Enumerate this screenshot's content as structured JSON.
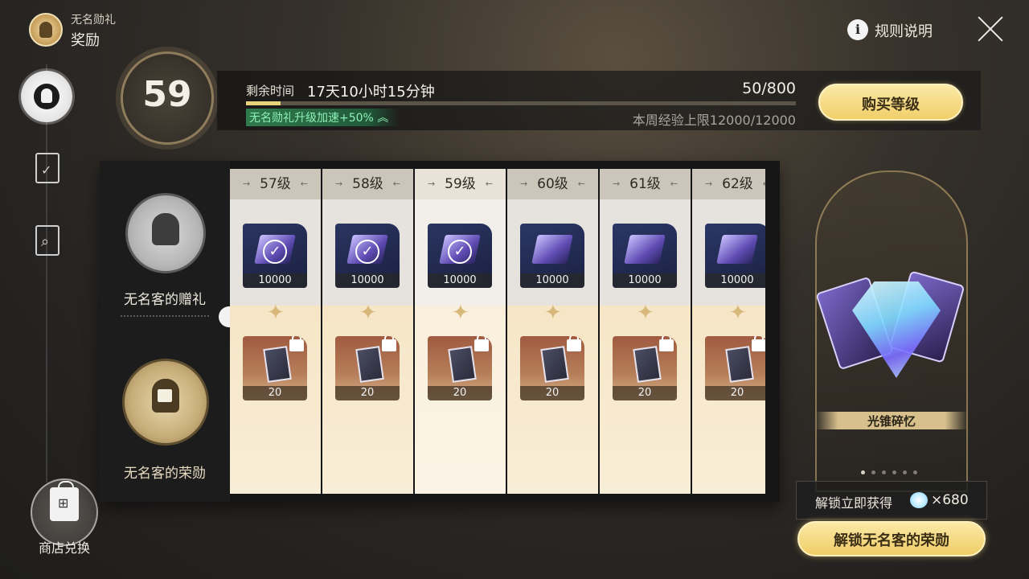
{
  "header": {
    "subtitle": "无名勋礼",
    "title": "奖励",
    "rules_label": "规则说明",
    "rules_icon": "info-icon",
    "close_icon": "close-icon"
  },
  "nav": {
    "items": [
      "reward-icon",
      "task-clipboard-icon",
      "search-document-icon"
    ],
    "shop_label": "商店兑换"
  },
  "level": {
    "current": "59",
    "time_label": "剩余时间",
    "time_value": "17天10小时15分钟",
    "exp_text": "50/800",
    "exp_fraction": 0.0625,
    "boost_text": "无名勋礼升级加速+50%",
    "weekly_cap": "本周经验上限12000/12000",
    "buy_label": "购买等级"
  },
  "tracks": {
    "free_label": "无名客的赠礼",
    "premium_label": "无名客的荣勋"
  },
  "levels": [
    {
      "label": "57级",
      "free_qty": "10000",
      "free_claimed": true,
      "premium_qty": "20",
      "premium_locked": true
    },
    {
      "label": "58级",
      "free_qty": "10000",
      "free_claimed": true,
      "premium_qty": "20",
      "premium_locked": true
    },
    {
      "label": "59级",
      "free_qty": "10000",
      "free_claimed": true,
      "premium_qty": "20",
      "premium_locked": true,
      "current": true
    },
    {
      "label": "60级",
      "free_qty": "10000",
      "free_claimed": false,
      "premium_qty": "20",
      "premium_locked": true
    },
    {
      "label": "61级",
      "free_qty": "10000",
      "free_claimed": false,
      "premium_qty": "20",
      "premium_locked": true
    },
    {
      "label": "62级",
      "free_qty": "10000",
      "free_claimed": false,
      "premium_qty": "20",
      "premium_locked": true
    }
  ],
  "feature": {
    "label": "光锥碎忆",
    "page_count": 6,
    "active_page": 1
  },
  "unlock": {
    "tip_text": "解锁立即获得",
    "jade_count": "×680",
    "button_label": "解锁无名客的荣勋"
  },
  "colors": {
    "accent_gold": "#f1cf6a",
    "boost_green": "#8ff0b7"
  }
}
